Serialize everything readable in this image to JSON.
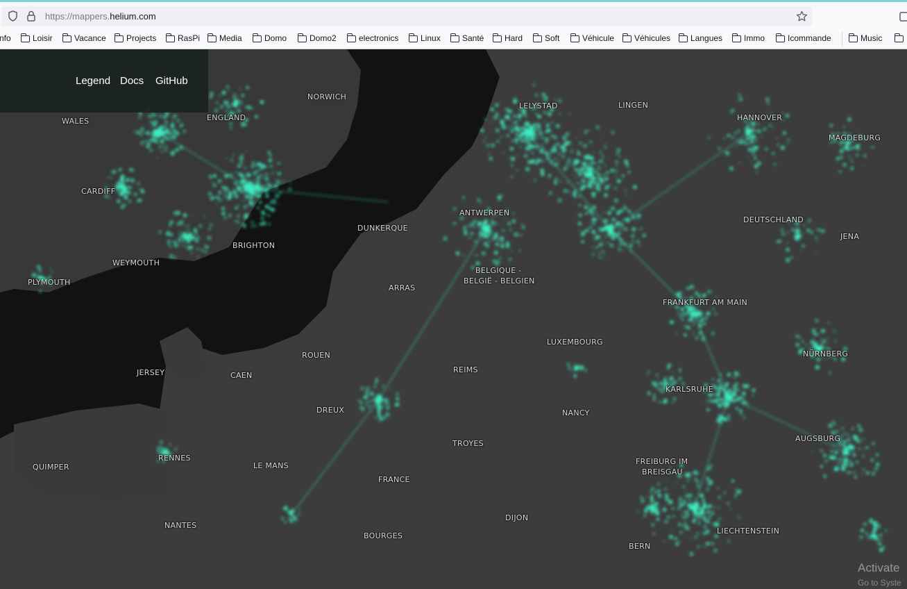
{
  "browser": {
    "url_prefix": "https://mappers.",
    "url_host": "helium.com",
    "bookmarks": [
      "nfo",
      "Loisir",
      "Vacance",
      "Projects",
      "RasPi",
      "Media",
      "Domo",
      "Domo2",
      "electronics",
      "Linux",
      "Santé",
      "Hard",
      "Soft",
      "Véhicule",
      "Véhicules",
      "Langues",
      "Immo",
      "Icommande",
      "Music"
    ]
  },
  "overlay": {
    "legend": "Legend",
    "docs": "Docs",
    "github": "GitHub"
  },
  "map": {
    "labels": {
      "wales": "WALES",
      "england": "ENGLAND",
      "norwich": "NORWICH",
      "cardiff": "CARDIFF",
      "weymouth": "WEYMOUTH",
      "plymouth": "PLYMOUTH",
      "brighton": "BRIGHTON",
      "dunkerque": "DUNKERQUE",
      "arras": "ARRAS",
      "lelystad": "LELYSTAD",
      "lingen": "LINGEN",
      "hannover": "HANNOVER",
      "magdeburg": "MAGDEBURG",
      "antwerpen": "ANTWERPEN",
      "deutschland": "DEUTSCHLAND",
      "jena": "JENA",
      "belgique1": "BELGIQUE -",
      "belgique2": "BELGIË - BELGIEN",
      "frankfurt": "FRANKFURT AM MAIN",
      "luxembourg": "LUXEMBOURG",
      "nurnberg": "NÜRNBERG",
      "jersey": "JERSEY",
      "rouen": "ROUEN",
      "caen": "CAEN",
      "reims": "REIMS",
      "karlsruhe": "KARLSRUHE",
      "dreux": "DREUX",
      "nancy": "NANCY",
      "troyes": "TROYES",
      "augsburg": "AUGSBURG",
      "rennes": "RENNES",
      "quimper": "QUIMPER",
      "lemans": "LE MANS",
      "freiburg1": "FREIBURG IM",
      "freiburg2": "BREISGAU",
      "france": "FRANCE",
      "dijon": "DIJON",
      "nantes": "NANTES",
      "bourges": "BOURGES",
      "liechtenstein": "LIECHTENSTEIN",
      "bern": "BERN"
    },
    "coverage_color": "#3ef0c3",
    "land_color": "#3b3b3b",
    "sea_color": "#121212"
  },
  "watermark": {
    "line1": "Activate",
    "line2": "Go to Syste"
  }
}
